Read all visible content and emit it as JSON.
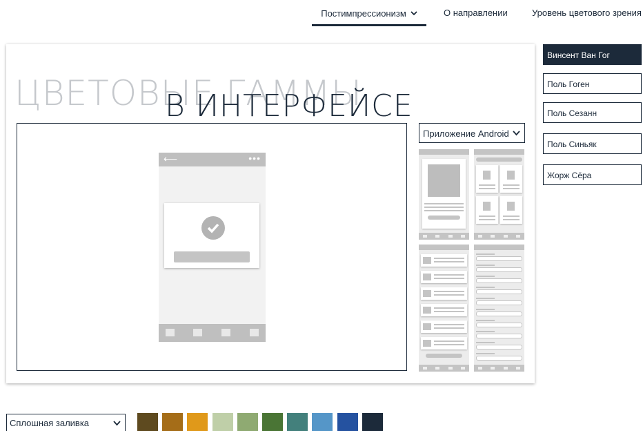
{
  "nav": {
    "active_label": "Постимпрессионизм",
    "about_label": "О направлении",
    "level_label": "Уровень цветового зрения"
  },
  "card": {
    "title_background": "ЦВЕТОВЫЕ ГАММЫ",
    "title_foreground": "В ИНТЕРФЕЙСЕ"
  },
  "app_select": {
    "selected": "Приложение Android"
  },
  "artists": [
    {
      "label": "Винсент Ван Гог",
      "active": true
    },
    {
      "label": "Поль Гоген",
      "active": false
    },
    {
      "label": "Поль Сезанн",
      "active": false
    },
    {
      "label": "Поль Синьяк",
      "active": false
    },
    {
      "label": "Жорж Сёра",
      "active": false
    }
  ],
  "fill_select": {
    "selected": "Сплошная заливка"
  },
  "palette": [
    "#5e4a1f",
    "#a56d18",
    "#e0991a",
    "#bfcfa8",
    "#8faa72",
    "#4a7535",
    "#43807c",
    "#5596c8",
    "#2552a0",
    "#1c2a3a"
  ],
  "colors": {
    "accent": "#1c2a3a"
  }
}
